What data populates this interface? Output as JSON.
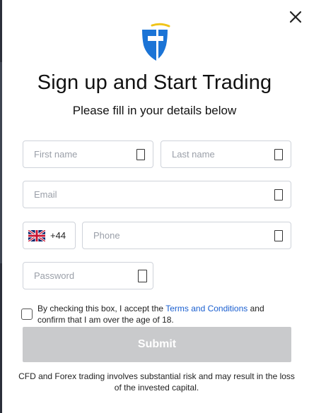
{
  "header": {
    "title": "Sign up and Start Trading",
    "subtitle": "Please fill in your details below"
  },
  "icons": {
    "close": "close-icon",
    "logo": "shield-logo-icon",
    "flag": "uk-flag-icon",
    "field_key": "password-manager-key-icon"
  },
  "colors": {
    "logo_blue": "#1b74d6",
    "logo_yellow": "#f0c419",
    "link": "#1a5fd0",
    "submit_disabled": "#c9cacc"
  },
  "form": {
    "first_name": {
      "placeholder": "First name",
      "value": ""
    },
    "last_name": {
      "placeholder": "Last name",
      "value": ""
    },
    "email": {
      "placeholder": "Email",
      "value": ""
    },
    "country_code": "+44",
    "phone": {
      "placeholder": "Phone",
      "value": ""
    },
    "password": {
      "placeholder": "Password",
      "value": ""
    }
  },
  "consent": {
    "checked": false,
    "text_before": "By checking this box, I accept the ",
    "link_text": "Terms and Conditions",
    "text_after": " and confirm that I am over the age of 18."
  },
  "submit_label": "Submit",
  "disclaimer": "CFD and Forex trading involves substantial risk and may result in the loss of the invested capital."
}
